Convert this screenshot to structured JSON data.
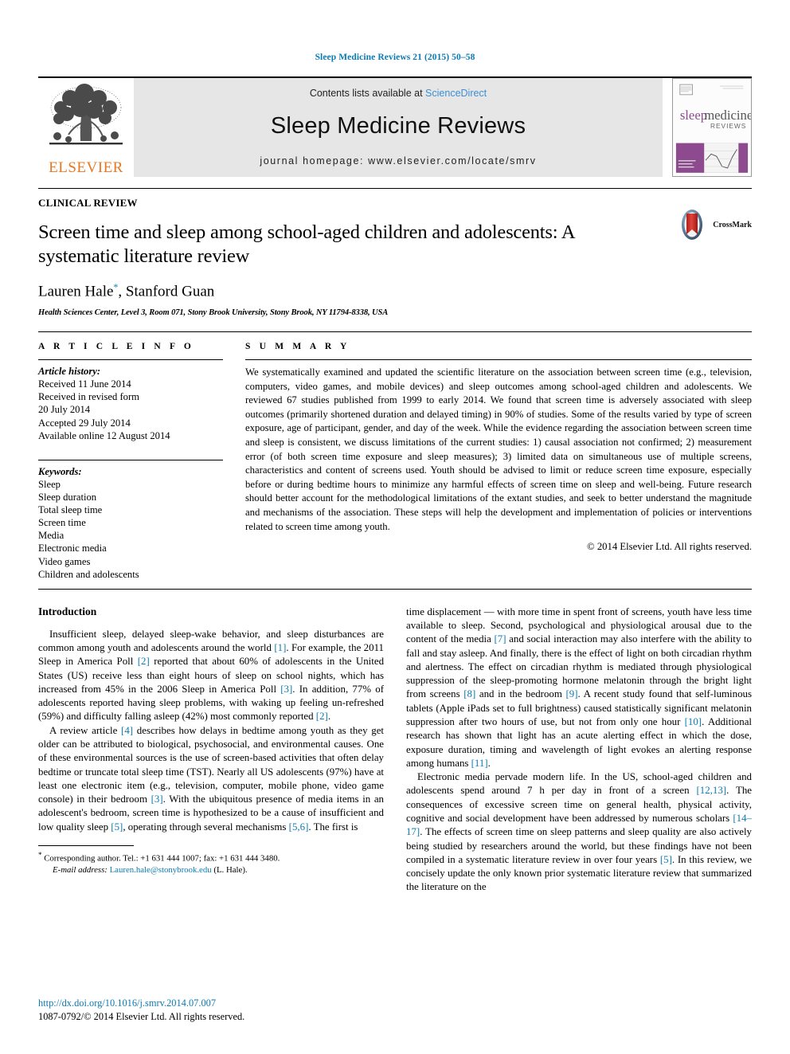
{
  "running_head": "Sleep Medicine Reviews 21 (2015) 50–58",
  "masthead": {
    "publisher_name": "ELSEVIER",
    "contents_prefix": "Contents lists available at",
    "sciencedirect": "ScienceDirect",
    "journal_title": "Sleep Medicine Reviews",
    "homepage": "journal homepage: www.elsevier.com/locate/smrv",
    "cover": {
      "title_part1": "sleep",
      "title_part2": "medicine",
      "subtitle": "REVIEWS",
      "accent_color": "#8e4a8e"
    }
  },
  "article": {
    "kicker": "CLINICAL REVIEW",
    "title": "Screen time and sleep among school-aged children and adolescents: A systematic literature review",
    "authors": "Lauren Hale",
    "authors_rest": ", Stanford Guan",
    "corresponding_marker": "*",
    "affiliation": "Health Sciences Center, Level 3, Room 071, Stony Brook University, Stony Brook, NY 11794-8338, USA",
    "crossmark_label": "CrossMark"
  },
  "article_info": {
    "heading": "A R T I C L E   I N F O",
    "history_label": "Article history:",
    "history": [
      "Received 11 June 2014",
      "Received in revised form",
      "20 July 2014",
      "Accepted 29 July 2014",
      "Available online 12 August 2014"
    ],
    "keywords_label": "Keywords:",
    "keywords": [
      "Sleep",
      "Sleep duration",
      "Total sleep time",
      "Screen time",
      "Media",
      "Electronic media",
      "Video games",
      "Children and adolescents"
    ]
  },
  "summary": {
    "heading": "S U M M A R Y",
    "text": "We systematically examined and updated the scientific literature on the association between screen time (e.g., television, computers, video games, and mobile devices) and sleep outcomes among school-aged children and adolescents. We reviewed 67 studies published from 1999 to early 2014. We found that screen time is adversely associated with sleep outcomes (primarily shortened duration and delayed timing) in 90% of studies. Some of the results varied by type of screen exposure, age of participant, gender, and day of the week. While the evidence regarding the association between screen time and sleep is consistent, we discuss limitations of the current studies: 1) causal association not confirmed; 2) measurement error (of both screen time exposure and sleep measures); 3) limited data on simultaneous use of multiple screens, characteristics and content of screens used. Youth should be advised to limit or reduce screen time exposure, especially before or during bedtime hours to minimize any harmful effects of screen time on sleep and well-being. Future research should better account for the methodological limitations of the extant studies, and seek to better understand the magnitude and mechanisms of the association. These steps will help the development and implementation of policies or interventions related to screen time among youth.",
    "copyright": "© 2014 Elsevier Ltd. All rights reserved."
  },
  "body": {
    "intro_heading": "Introduction",
    "left": {
      "p1_a": "Insufficient sleep, delayed sleep-wake behavior, and sleep disturbances are common among youth and adolescents around the world ",
      "p1_r1": "[1]",
      "p1_b": ". For example, the 2011 Sleep in America Poll ",
      "p1_r2": "[2]",
      "p1_c": " reported that about 60% of adolescents in the United States (US) receive less than eight hours of sleep on school nights, which has increased from 45% in the 2006 Sleep in America Poll ",
      "p1_r3": "[3]",
      "p1_d": ". In addition, 77% of adolescents reported having sleep problems, with waking up feeling un-refreshed (59%) and difficulty falling asleep (42%) most commonly reported ",
      "p1_r4": "[2]",
      "p1_e": ".",
      "p2_a": "A review article ",
      "p2_r1": "[4]",
      "p2_b": " describes how delays in bedtime among youth as they get older can be attributed to biological, psychosocial, and environmental causes. One of these environmental sources is the use of screen-based activities that often delay bedtime or truncate total sleep time (TST). Nearly all US adolescents (97%) have at least one electronic item (e.g., television, computer, mobile phone, video game console) in their bedroom ",
      "p2_r2": "[3]",
      "p2_c": ". With the ubiquitous presence of media items in an adolescent's bedroom, screen time is hypothesized to be a cause of insufficient and low quality sleep ",
      "p2_r3": "[5]",
      "p2_d": ", operating through several mechanisms ",
      "p2_r4": "[5,6]",
      "p2_e": ". The first is"
    },
    "right": {
      "p1_a": "time displacement — with more time in spent front of screens, youth have less time available to sleep. Second, psychological and physiological arousal due to the content of the media ",
      "p1_r1": "[7]",
      "p1_b": " and social interaction may also interfere with the ability to fall and stay asleep. And finally, there is the effect of light on both circadian rhythm and alertness. The effect on circadian rhythm is mediated through physiological suppression of the sleep-promoting hormone melatonin through the bright light from screens ",
      "p1_r2": "[8]",
      "p1_c": " and in the bedroom ",
      "p1_r3": "[9]",
      "p1_d": ". A recent study found that self-luminous tablets (Apple iPads set to full brightness) caused statistically significant melatonin suppression after two hours of use, but not from only one hour ",
      "p1_r4": "[10]",
      "p1_e": ". Additional research has shown that light has an acute alerting effect in which the dose, exposure duration, timing and wavelength of light evokes an alerting response among humans ",
      "p1_r5": "[11]",
      "p1_f": ".",
      "p2_a": "Electronic media pervade modern life. In the US, school-aged children and adolescents spend around 7 h per day in front of a screen ",
      "p2_r1": "[12,13]",
      "p2_b": ". The consequences of excessive screen time on general health, physical activity, cognitive and social development have been addressed by numerous scholars ",
      "p2_r2": "[14–17]",
      "p2_c": ". The effects of screen time on sleep patterns and sleep quality are also actively being studied by researchers around the world, but these findings have not been compiled in a systematic literature review in over four years ",
      "p2_r3": "[5]",
      "p2_d": ". In this review, we concisely update the only known prior systematic literature review that summarized the literature on the"
    }
  },
  "footnotes": {
    "corresponding": "Corresponding author. Tel.: +1 631 444 1007; fax: +1 631 444 3480.",
    "email_label": "E-mail address:",
    "email": "Lauren.hale@stonybrook.edu",
    "email_suffix": "(L. Hale)."
  },
  "footer": {
    "doi": "http://dx.doi.org/10.1016/j.smrv.2014.07.007",
    "issn": "1087-0792/© 2014 Elsevier Ltd. All rights reserved."
  },
  "colors": {
    "link": "#0b7bb5",
    "sciencedirect": "#3b8fd4",
    "elsevier_orange": "#E87722",
    "crossmark_red": "#cc2b28"
  }
}
